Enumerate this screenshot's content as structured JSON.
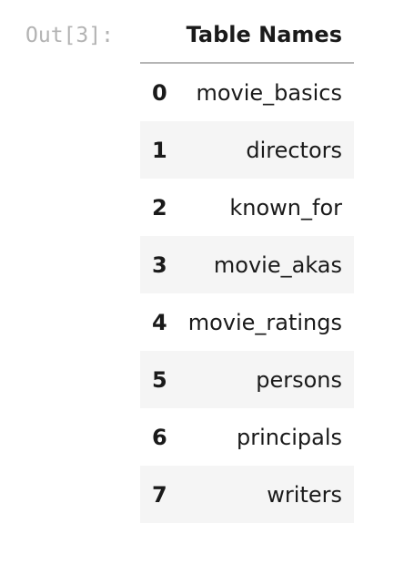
{
  "cell": {
    "prompt": "Out[3]:"
  },
  "table": {
    "column_header": "Table Names",
    "rows": [
      {
        "index": "0",
        "value": "movie_basics"
      },
      {
        "index": "1",
        "value": "directors"
      },
      {
        "index": "2",
        "value": "known_for"
      },
      {
        "index": "3",
        "value": "movie_akas"
      },
      {
        "index": "4",
        "value": "movie_ratings"
      },
      {
        "index": "5",
        "value": "persons"
      },
      {
        "index": "6",
        "value": "principals"
      },
      {
        "index": "7",
        "value": "writers"
      }
    ]
  }
}
